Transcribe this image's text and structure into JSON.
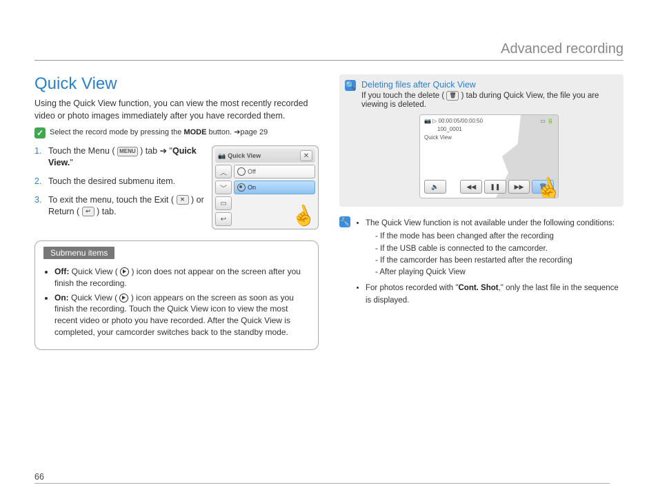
{
  "chapter": "Advanced recording",
  "pageNumber": "66",
  "left": {
    "title": "Quick View",
    "intro": "Using the Quick View function, you can view the most recently recorded video or photo images immediately after you have recorded them.",
    "modeNote_pre": "Select the record mode by pressing the ",
    "modeNote_strong": "MODE",
    "modeNote_post": " button. ➔page 29",
    "steps": {
      "s1a": "Touch the Menu ( ",
      "s1_icon": "MENU",
      "s1b": " ) tab ➔ \"",
      "s1_strong": "Quick View.",
      "s1c": "\"",
      "s2": "Touch the desired submenu item.",
      "s3a": "To exit the menu, touch the Exit ( ",
      "s3b": " ) or Return ( ",
      "s3c": " ) tab."
    },
    "menuss": {
      "title": "Quick View",
      "optOff": "Off",
      "optOn": "On"
    },
    "submenuTag": "Submenu items",
    "sub_off_label": "Off:",
    "sub_off_text": " Quick View ( ",
    "sub_off_text2": " ) icon does not appear on the screen after you finish the recording.",
    "sub_on_label": "On:",
    "sub_on_text": " Quick View ( ",
    "sub_on_text2": " ) icon appears on the screen as soon as you finish the recording. Touch the Quick View icon to view the most recent video or photo you have recorded. After the Quick View is completed, your camcorder switches back to the standby mode."
  },
  "right": {
    "delTitle": "Deleting files after Quick View",
    "delText_a": "If you touch the delete ( ",
    "delText_b": " ) tab during Quick View, the file you are viewing is deleted.",
    "player": {
      "time": "00:00:05/00:00:50",
      "file": "100_0001",
      "label": "Quick View"
    },
    "notes": {
      "n1": "The Quick View function is not available under the following conditions:",
      "n1a": "If the mode has been changed after the recording",
      "n1b": "If the USB cable is connected to the camcorder.",
      "n1c": "If the camcorder has been restarted after the recording",
      "n1d": "After playing Quick View",
      "n2a": "For photos recorded with \"",
      "n2strong": "Cont. Shot",
      "n2b": ",\" only the last file in the sequence is displayed."
    }
  }
}
